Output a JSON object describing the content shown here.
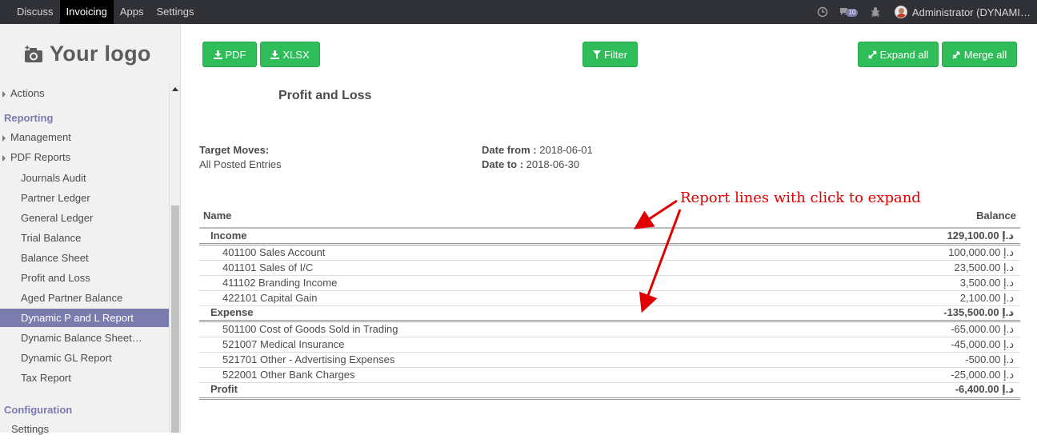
{
  "topbar": {
    "menu": [
      "Discuss",
      "Invoicing",
      "Apps",
      "Settings"
    ],
    "active": "Invoicing",
    "messages_badge": "10",
    "user": "Administrator (DYNAMI…"
  },
  "sidebar": {
    "logo_text": "Your logo",
    "items": [
      {
        "label": "Actions",
        "kind": "caret"
      },
      {
        "label": "Reporting",
        "kind": "head"
      },
      {
        "label": "Management",
        "kind": "caret"
      },
      {
        "label": "PDF Reports",
        "kind": "caret"
      },
      {
        "label": "Journals Audit",
        "kind": "sub"
      },
      {
        "label": "Partner Ledger",
        "kind": "sub"
      },
      {
        "label": "General Ledger",
        "kind": "sub"
      },
      {
        "label": "Trial Balance",
        "kind": "sub"
      },
      {
        "label": "Balance Sheet",
        "kind": "sub"
      },
      {
        "label": "Profit and Loss",
        "kind": "sub"
      },
      {
        "label": "Aged Partner Balance",
        "kind": "sub"
      },
      {
        "label": "Dynamic P and L Report",
        "kind": "sub",
        "active": true
      },
      {
        "label": "Dynamic Balance Sheet…",
        "kind": "sub"
      },
      {
        "label": "Dynamic GL Report",
        "kind": "sub"
      },
      {
        "label": "Tax Report",
        "kind": "sub"
      },
      {
        "label": "Configuration",
        "kind": "head"
      },
      {
        "label": "Settings",
        "kind": "plain"
      }
    ]
  },
  "toolbar": {
    "pdf": "PDF",
    "xlsx": "XLSX",
    "filter": "Filter",
    "expand_all": "Expand all",
    "merge_all": "Merge all"
  },
  "report": {
    "title": "Profit and Loss",
    "target_moves_label": "Target Moves:",
    "target_moves_value": "All Posted Entries",
    "date_from_label": "Date from :",
    "date_from_value": "2018-06-01",
    "date_to_label": "Date to :",
    "date_to_value": "2018-06-30",
    "col_name": "Name",
    "col_balance": "Balance",
    "lines": [
      {
        "name": "Income",
        "balance": "129,100.00 د.إ",
        "group": true
      },
      {
        "name": "401100 Sales Account",
        "balance": "100,000.00 د.إ"
      },
      {
        "name": "401101 Sales of I/C",
        "balance": "23,500.00 د.إ"
      },
      {
        "name": "411102 Branding Income",
        "balance": "3,500.00 د.إ"
      },
      {
        "name": "422101 Capital Gain",
        "balance": "2,100.00 د.إ"
      },
      {
        "name": "Expense",
        "balance": "-135,500.00 د.إ",
        "group": true
      },
      {
        "name": "501100 Cost of Goods Sold in Trading",
        "balance": "-65,000.00 د.إ"
      },
      {
        "name": "521007 Medical Insurance",
        "balance": "-45,000.00 د.إ"
      },
      {
        "name": "521701 Other - Advertising Expenses",
        "balance": "-500.00 د.إ"
      },
      {
        "name": "522001 Other Bank Charges",
        "balance": "-25,000.00 د.إ"
      },
      {
        "name": "Profit",
        "balance": "-6,400.00 د.إ",
        "group": true
      }
    ]
  },
  "annotation": {
    "text": "Report lines with click to expand",
    "color": "#e00000"
  },
  "colors": {
    "accent": "#7c7bad",
    "button": "#2ebd59",
    "topbar": "#2f3136"
  }
}
